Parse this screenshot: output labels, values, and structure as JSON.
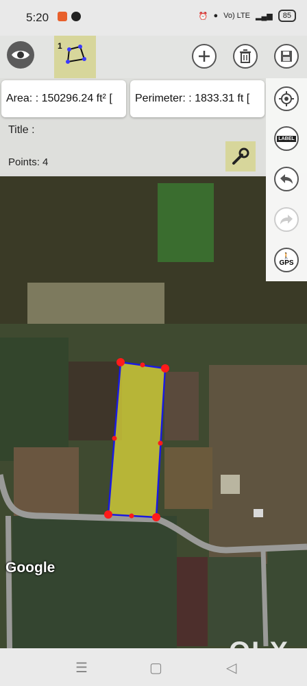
{
  "status_bar": {
    "time": "5:20",
    "network_label": "Vo) LTE",
    "battery": "85"
  },
  "toolbar": {
    "visibility_icon": "eye-icon",
    "polygon_tool_index": "1",
    "polygon_tool_icon": "polygon-icon",
    "add_icon": "plus-icon",
    "delete_icon": "trash-icon",
    "save_icon": "floppy-disk-icon"
  },
  "measurements": {
    "area": "Area: : 150296.24 ft² [",
    "perimeter": "Perimeter: : 1833.31 ft [",
    "title": "Title :",
    "points": "Points: 4"
  },
  "side_tools": {
    "location_icon": "crosshair-icon",
    "label_button": "LABEL",
    "undo_icon": "undo-icon",
    "redo_icon": "redo-icon",
    "gps_button": "GPS",
    "settings_icon": "wrench-icon"
  },
  "map": {
    "provider": "Google",
    "watermark": "OLX",
    "polygon_fill": "#d8d43a",
    "polygon_stroke": "#1a1ae0",
    "vertex_color": "#ff1a1a"
  },
  "nav_bar": {
    "menu_icon": "menu-icon",
    "home_icon": "square-icon",
    "back_icon": "triangle-back-icon"
  }
}
